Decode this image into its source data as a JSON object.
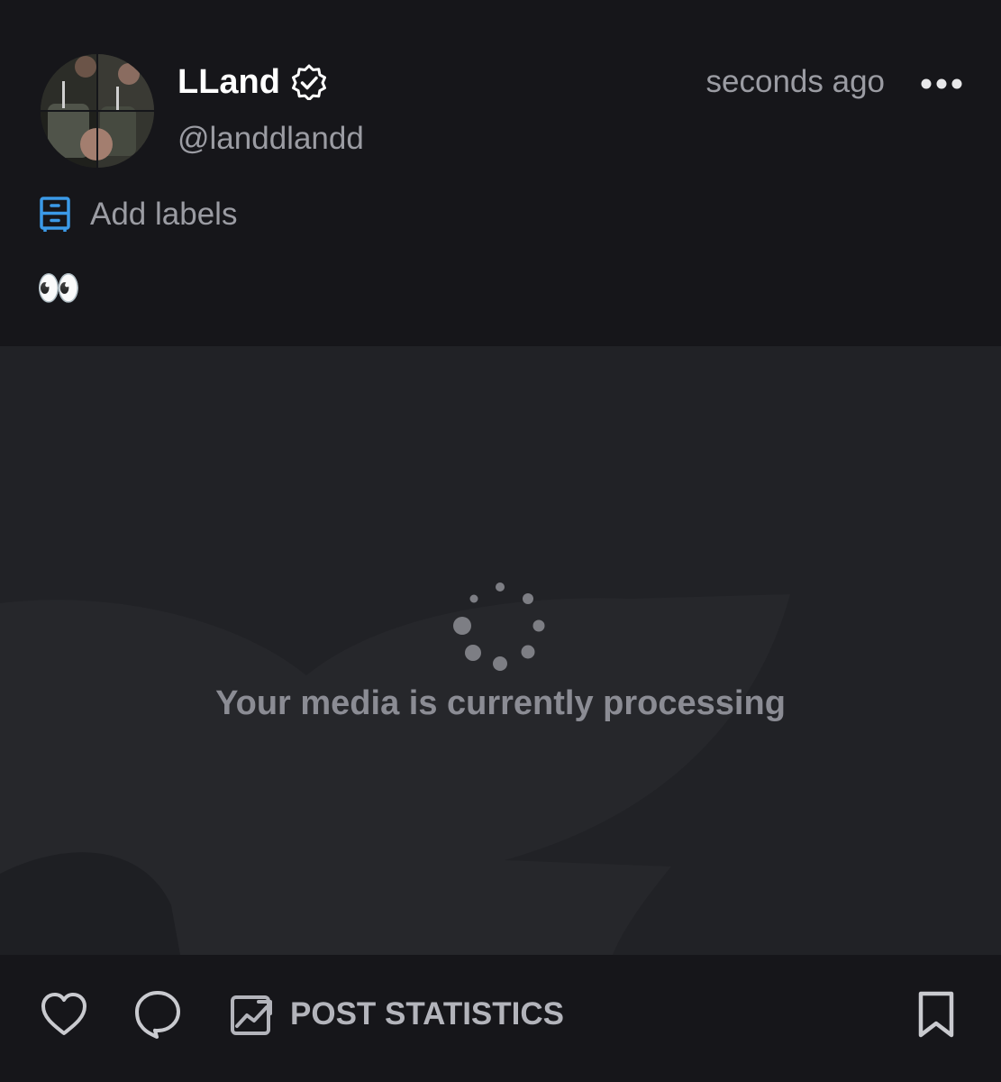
{
  "author": {
    "display_name": "LLand",
    "handle": "@landdlandd",
    "verified_icon": "verified-badge-icon",
    "avatar_icon": "avatar"
  },
  "timestamp": "seconds ago",
  "more_icon": "more-horizontal-icon",
  "labels": {
    "icon": "labels-icon",
    "text": "Add labels"
  },
  "post": {
    "text": "👀"
  },
  "media": {
    "status_text": "Your media is currently processing",
    "spinner_icon": "loading-spinner-icon"
  },
  "actions": {
    "like_icon": "heart-icon",
    "comment_icon": "comment-icon",
    "stats_icon": "chart-icon",
    "stats_label": "POST STATISTICS",
    "bookmark_icon": "bookmark-icon"
  },
  "colors": {
    "background": "#16161a",
    "media_background": "#212226",
    "primary_text": "#ffffff",
    "secondary_text": "#9b9ca3",
    "accent_blue": "#3b9ae8"
  }
}
